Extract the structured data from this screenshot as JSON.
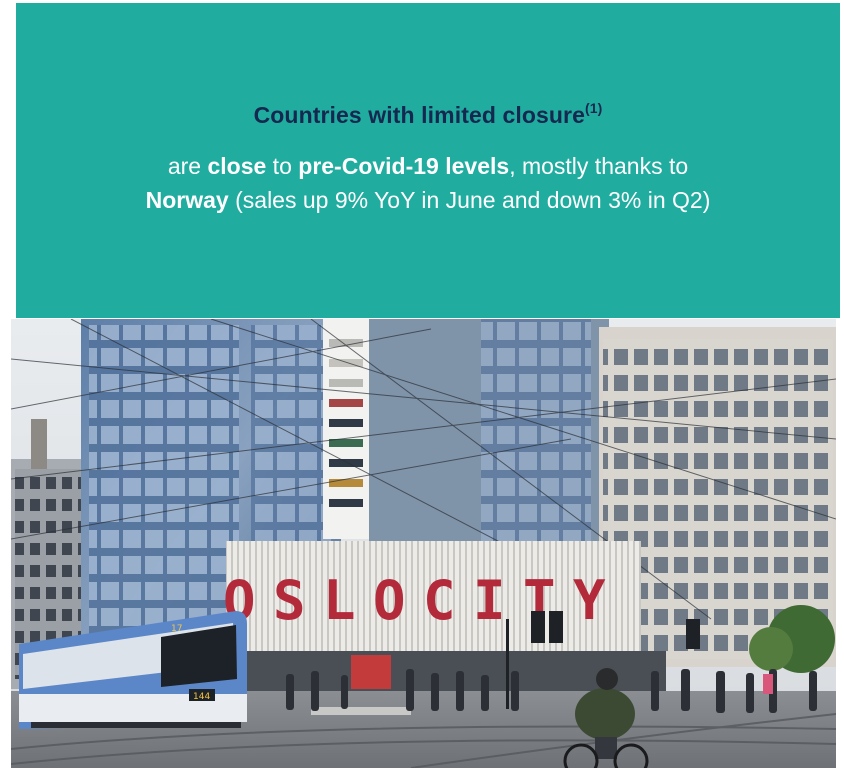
{
  "slide": {
    "headline": "Countries with limited closure",
    "headline_footnote": "(1)",
    "line1_part1": "are ",
    "line1_bold1": "close",
    "line1_part2": " to ",
    "line1_bold2": "pre-Covid-19 levels",
    "line1_part3": ", mostly thanks to",
    "line2_bold": "Norway",
    "line2_rest": " (sales up 9% YoY in June and down 3% in Q2)"
  },
  "photo": {
    "sign_letters": [
      "O",
      "S",
      "L",
      "O",
      "C",
      "I",
      "T",
      "Y"
    ],
    "tram_number": "144",
    "tram_route": "17"
  },
  "colors": {
    "panel": "#20ada0",
    "headline": "#15284f",
    "body_text": "#ffffff",
    "sign_letters": "#b32a3a"
  }
}
